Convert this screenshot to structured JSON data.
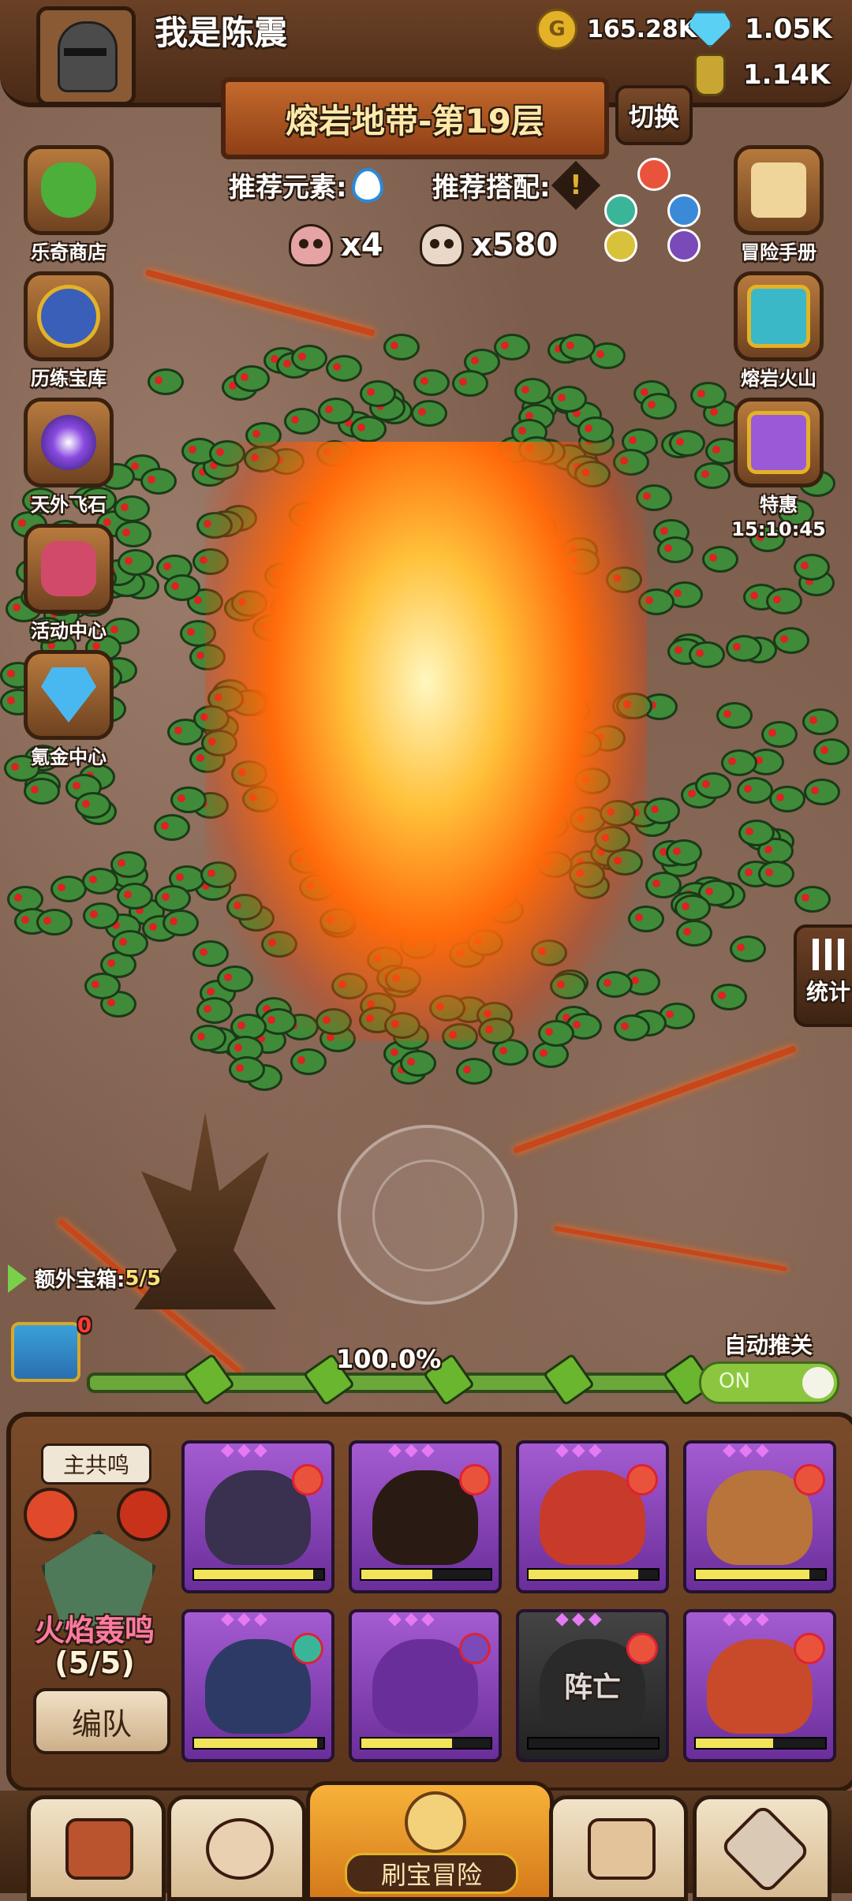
{
  "player": {
    "name": "我是陈震"
  },
  "resources": {
    "gold": "165.28K",
    "gems": "1.05K",
    "potion": "1.14K"
  },
  "level": {
    "title": "熔岩地带-第19层",
    "switch_label": "切换"
  },
  "recommend": {
    "element_label": "推荐元素:",
    "combo_label": "推荐搭配:",
    "combo_symbol": "!"
  },
  "kills": {
    "elite": "x4",
    "normal": "x580"
  },
  "left_menu": [
    {
      "label": "乐奇商店",
      "icon": "clover-icon"
    },
    {
      "label": "历练宝库",
      "icon": "treasure-scroll-icon"
    },
    {
      "label": "天外飞石",
      "icon": "portal-icon"
    },
    {
      "label": "活动中心",
      "icon": "flower-bouquet-icon"
    },
    {
      "label": "氪金中心",
      "icon": "diamond-icon"
    }
  ],
  "right_menu": [
    {
      "label": "冒险手册",
      "icon": "scroll-icon"
    },
    {
      "label": "熔岩火山",
      "icon": "chest-icon"
    },
    {
      "label": "特惠",
      "timer": "15:10:45",
      "icon": "gift-chest-icon"
    }
  ],
  "stats": {
    "label": "统计"
  },
  "extra_chest": {
    "label": "额外宝箱:",
    "value": "5/5",
    "badge": "0"
  },
  "progress": {
    "percent_label": "100.0%",
    "fill": 1.0
  },
  "auto_push": {
    "label": "自动推关",
    "state": "ON"
  },
  "team": {
    "resonance_label": "主共鸣",
    "name": "火焰轰鸣",
    "count": "(5/5)",
    "formation_button": "编队",
    "heroes": [
      {
        "name": "hero-wizard-skull",
        "hp": 0.92,
        "element": "fire"
      },
      {
        "name": "hero-burnt-monk",
        "hp": 0.55,
        "element": "fire"
      },
      {
        "name": "hero-red-demon",
        "hp": 0.85,
        "element": "fire"
      },
      {
        "name": "hero-turban-warrior",
        "hp": 0.88,
        "element": "fire"
      },
      {
        "name": "hero-pirate-skull",
        "hp": 0.95,
        "element": "wind"
      },
      {
        "name": "hero-purple-wizard",
        "hp": 0.7,
        "element": "moon"
      },
      {
        "name": "hero-dead",
        "hp": 0.0,
        "element": "fire",
        "status": "阵亡"
      },
      {
        "name": "hero-horned-ogre",
        "hp": 0.6,
        "element": "fire"
      }
    ]
  },
  "bottom_nav": {
    "center_label": "刷宝冒险"
  },
  "colors": {
    "accent": "#c46a2c",
    "gold": "#e3b227",
    "toggle_on": "#8cc63f",
    "hero_frame": "#7a3aa8"
  }
}
